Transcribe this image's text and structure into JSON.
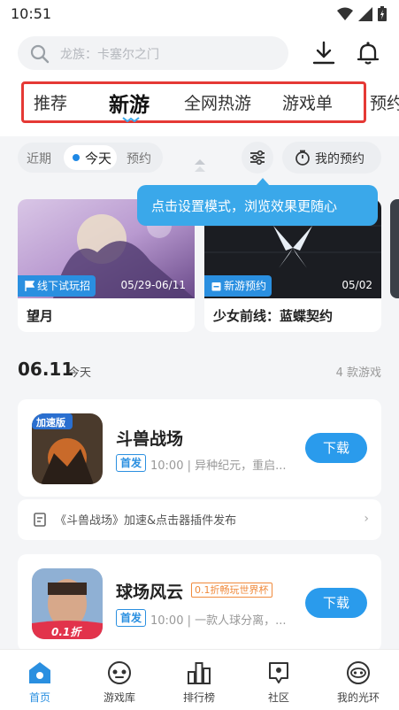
{
  "status_bar": {
    "time": "10:51"
  },
  "search": {
    "placeholder": "龙族：卡塞尔之门"
  },
  "tabs": [
    {
      "label": "推荐",
      "active": false
    },
    {
      "label": "新游",
      "active": true
    },
    {
      "label": "全网热游",
      "active": false
    },
    {
      "label": "游戏单",
      "active": false
    },
    {
      "label": "预约",
      "active": false
    }
  ],
  "filter": {
    "recent": "近期",
    "today": "今天",
    "reserve": "预约",
    "my_reservations": "我的预约"
  },
  "tooltip": {
    "text": "点击设置模式，浏览效果更随心"
  },
  "banners": [
    {
      "tag": "线下试玩招",
      "date": "05/29-06/11",
      "title": "望月"
    },
    {
      "tag": "新游预约",
      "date": "05/02",
      "title": "少女前线：蓝蝶契约"
    }
  ],
  "section": {
    "date": "06.11",
    "day": "今天",
    "count": "4 款游戏"
  },
  "games": [
    {
      "name": "斗兽战场",
      "icon_label": "加速版",
      "badge": "首发",
      "time": "10:00",
      "desc": "异种纪元，重启...",
      "button": "下载",
      "promo": ""
    },
    {
      "name": "球场风云",
      "icon_label": "0.1折",
      "badge": "首发",
      "time": "10:00",
      "desc": "一款人球分离，...",
      "button": "下载",
      "promo": "0.1折畅玩世界杯"
    }
  ],
  "news": {
    "text": "《斗兽战场》加速&点击器插件发布"
  },
  "bottom_nav": [
    {
      "label": "首页",
      "icon": "home-icon",
      "active": true
    },
    {
      "label": "游戏库",
      "icon": "gamepad-icon",
      "active": false
    },
    {
      "label": "排行榜",
      "icon": "ranking-icon",
      "active": false
    },
    {
      "label": "社区",
      "icon": "community-icon",
      "active": false
    },
    {
      "label": "我的光环",
      "icon": "profile-icon",
      "active": false
    }
  ],
  "colors": {
    "accent": "#2a8fe0",
    "highlight_box": "#e53935",
    "tooltip": "#3aa8ea",
    "promo": "#f08a3c"
  }
}
